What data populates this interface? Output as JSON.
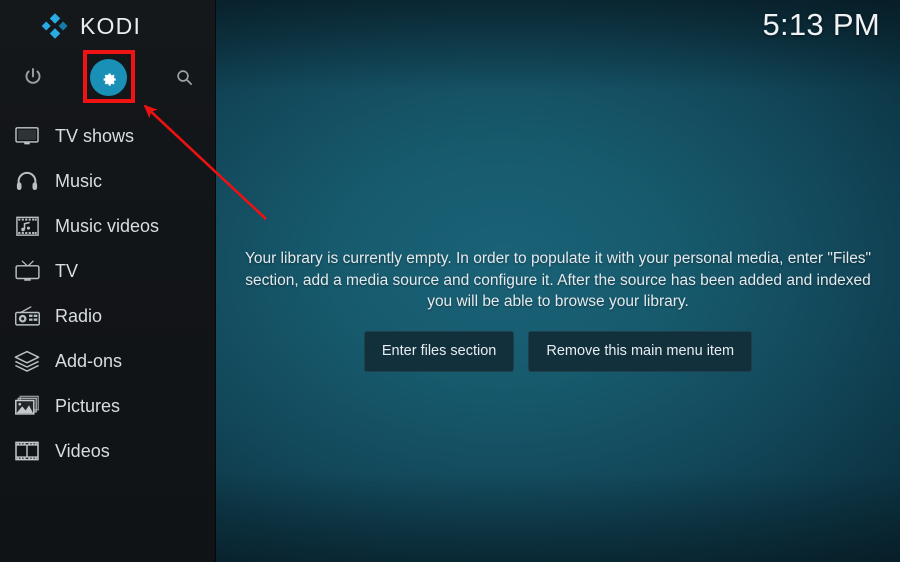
{
  "app": {
    "name": "KODI",
    "logo_icon": "kodi-logo-icon",
    "brand_color": "#29abe2"
  },
  "clock": {
    "time": "5:13 PM"
  },
  "sidebar": {
    "top_actions": [
      {
        "name": "power",
        "label": "Power",
        "icon": "power-icon"
      },
      {
        "name": "settings",
        "label": "Settings",
        "icon": "gear-icon",
        "highlighted": true,
        "highlight_color": "#ef1313",
        "accent_color": "#1a90b6"
      },
      {
        "name": "search",
        "label": "Search",
        "icon": "search-icon"
      }
    ],
    "items": [
      {
        "label": "TV shows",
        "icon": "tv-monitor-icon"
      },
      {
        "label": "Music",
        "icon": "headphones-icon"
      },
      {
        "label": "Music videos",
        "icon": "music-video-icon"
      },
      {
        "label": "TV",
        "icon": "television-icon"
      },
      {
        "label": "Radio",
        "icon": "radio-icon"
      },
      {
        "label": "Add-ons",
        "icon": "addons-box-icon"
      },
      {
        "label": "Pictures",
        "icon": "pictures-icon"
      },
      {
        "label": "Videos",
        "icon": "film-strip-icon"
      }
    ]
  },
  "main": {
    "empty_message": "Your library is currently empty. In order to populate it with your personal media, enter \"Files\" section, add a media source and configure it. After the source has been added and indexed you will be able to browse your library.",
    "buttons": [
      {
        "label": "Enter files section"
      },
      {
        "label": "Remove this main menu item"
      }
    ]
  },
  "annotation": {
    "arrow_color": "#ee1111",
    "points_to": "settings-gear-button"
  }
}
